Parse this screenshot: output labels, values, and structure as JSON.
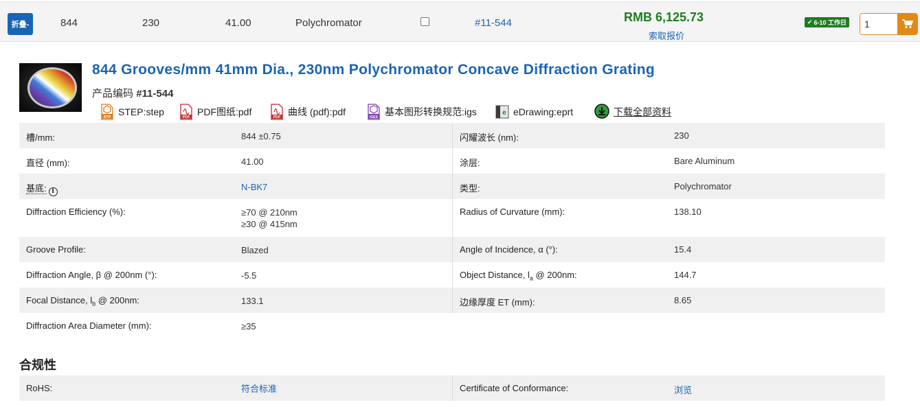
{
  "toprow": {
    "collapse_label": "折叠-",
    "grooves": "844",
    "blaze": "230",
    "diameter": "41.00",
    "type": "Polychromator",
    "part_number": "#11-544",
    "price": "RMB 6,125.73",
    "quote_label": "索取报价",
    "lead_time_badge": "6-10 工作日",
    "quantity_value": "1"
  },
  "product": {
    "title": "844 Grooves/mm 41mm Dia., 230nm Polychromator Concave Diffraction Grating",
    "code_label": "产品编码",
    "code": "#11-544",
    "files": [
      {
        "label": "STEP:step",
        "icon": "step-file-icon"
      },
      {
        "label": "PDF图纸:pdf",
        "icon": "pdf-icon"
      },
      {
        "label": "曲线 (pdf):pdf",
        "icon": "pdf-icon"
      },
      {
        "label": "基本图形转换规范:igs",
        "icon": "iges-file-icon"
      },
      {
        "label": "eDrawing:eprt",
        "icon": "edrawing-icon"
      },
      {
        "label": "下载全部资料",
        "icon": "download-icon"
      }
    ]
  },
  "specs": [
    {
      "l1": "槽/mm:",
      "v1": "844 ±0.75",
      "l2": "闪耀波长 (nm):",
      "v2": "230"
    },
    {
      "l1": "直径 (mm):",
      "v1": "41.00",
      "l2": "涂层:",
      "v2": "Bare Aluminum"
    },
    {
      "l1": "基底:",
      "v1": "N-BK7",
      "l2": "类型:",
      "v2": "Polychromator"
    },
    {
      "l1": "Diffraction Efficiency (%):",
      "v1a": "≥70 @ 210nm",
      "v1b": "≥30 @ 415nm",
      "l2": "Radius of Curvature (mm):",
      "v2": "138.10"
    },
    {
      "l1": "Groove Profile:",
      "v1": "Blazed",
      "l2": "Angle of Incidence, α (°):",
      "v2": "15.4"
    },
    {
      "l1": "Diffraction Angle, β @ 200nm (°):",
      "v1": "-5.5",
      "l2a": "Object Distance, l",
      "l2sub": "a",
      "l2b": " @ 200nm:",
      "v2": "144.7"
    },
    {
      "l1a": "Focal Distance, l",
      "l1sub": "b",
      "l1b": " @ 200nm:",
      "v1": "133.1",
      "l2": "边缘厚度 ET (mm):",
      "v2": "8.65"
    },
    {
      "l1": "Diffraction Area Diameter (mm):",
      "v1": "≥35"
    }
  ],
  "compliance": {
    "title": "合规性",
    "rohs_label": "RoHS:",
    "rohs_value": "符合标准",
    "coc_label": "Certificate of Conformance:",
    "coc_value": "浏览"
  },
  "colors": {
    "link": "#1a64b5",
    "price": "#1f7d1f",
    "accent": "#e08a16",
    "row_shade": "#f0f0f0"
  }
}
